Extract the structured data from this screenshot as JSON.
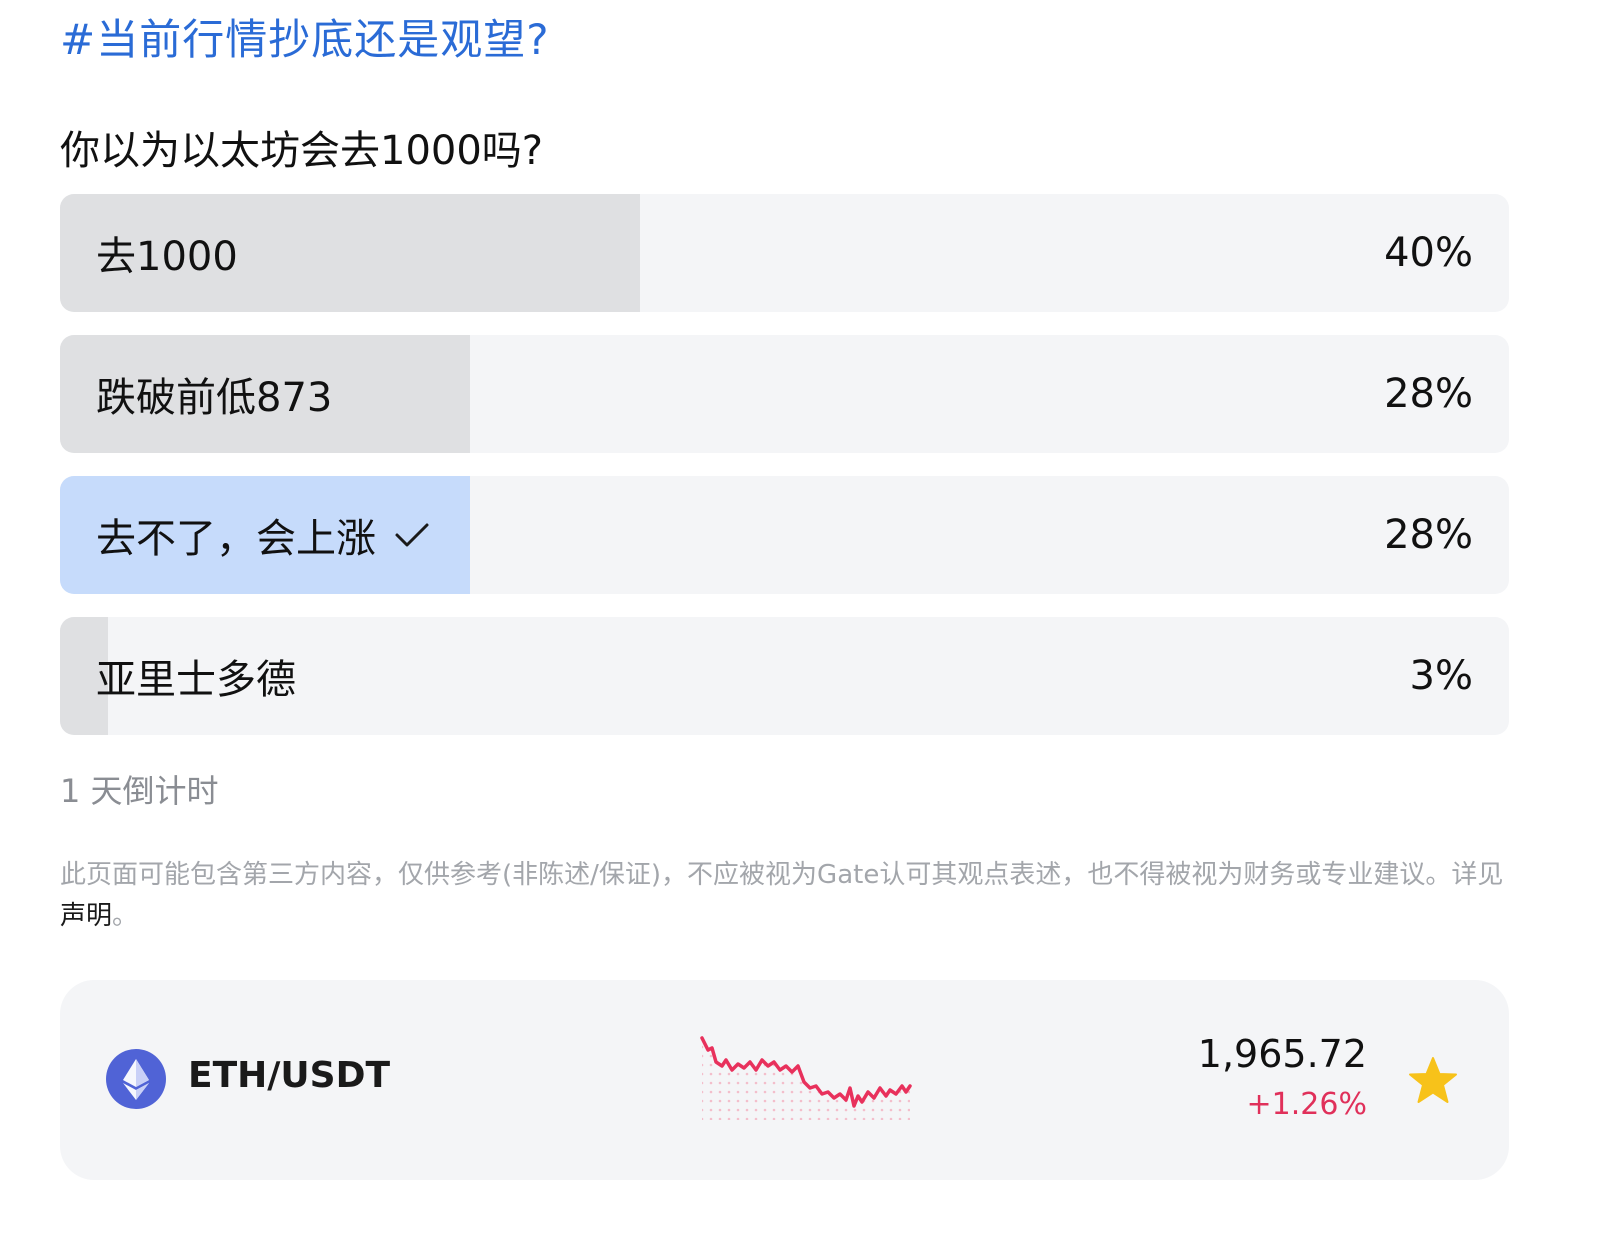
{
  "topic": "#当前行情抄底还是观望?",
  "question": "你以为以太坊会去1000吗?",
  "options": [
    {
      "label": "去1000",
      "percent": "40%",
      "fraction": 0.4,
      "selected": false
    },
    {
      "label": "跌破前低873",
      "percent": "28%",
      "fraction": 0.283,
      "selected": false
    },
    {
      "label": "去不了，会上涨",
      "percent": "28%",
      "fraction": 0.283,
      "selected": true
    },
    {
      "label": "亚里士多德",
      "percent": "3%",
      "fraction": 0.033,
      "selected": false
    }
  ],
  "countdown": "1 天倒计时",
  "disclaimer": {
    "text": "此页面可能包含第三方内容，仅供参考(非陈述/保证)，不应被视为Gate认可其观点表述，也不得被视为财务或专业建议。详见",
    "link": "声明",
    "end": "。"
  },
  "ticker": {
    "pair": "ETH/USDT",
    "price": "1,965.72",
    "change": "+1.26%",
    "icon": "ethereum-icon",
    "favorite_icon": "star-icon"
  },
  "colors": {
    "topic": "#2a6bd6",
    "selected_fill": "#c6dbfb",
    "fill": "#dfe0e2",
    "change_negative": "#e0305a",
    "star": "#f7c21a",
    "eth": "#5063d6"
  }
}
